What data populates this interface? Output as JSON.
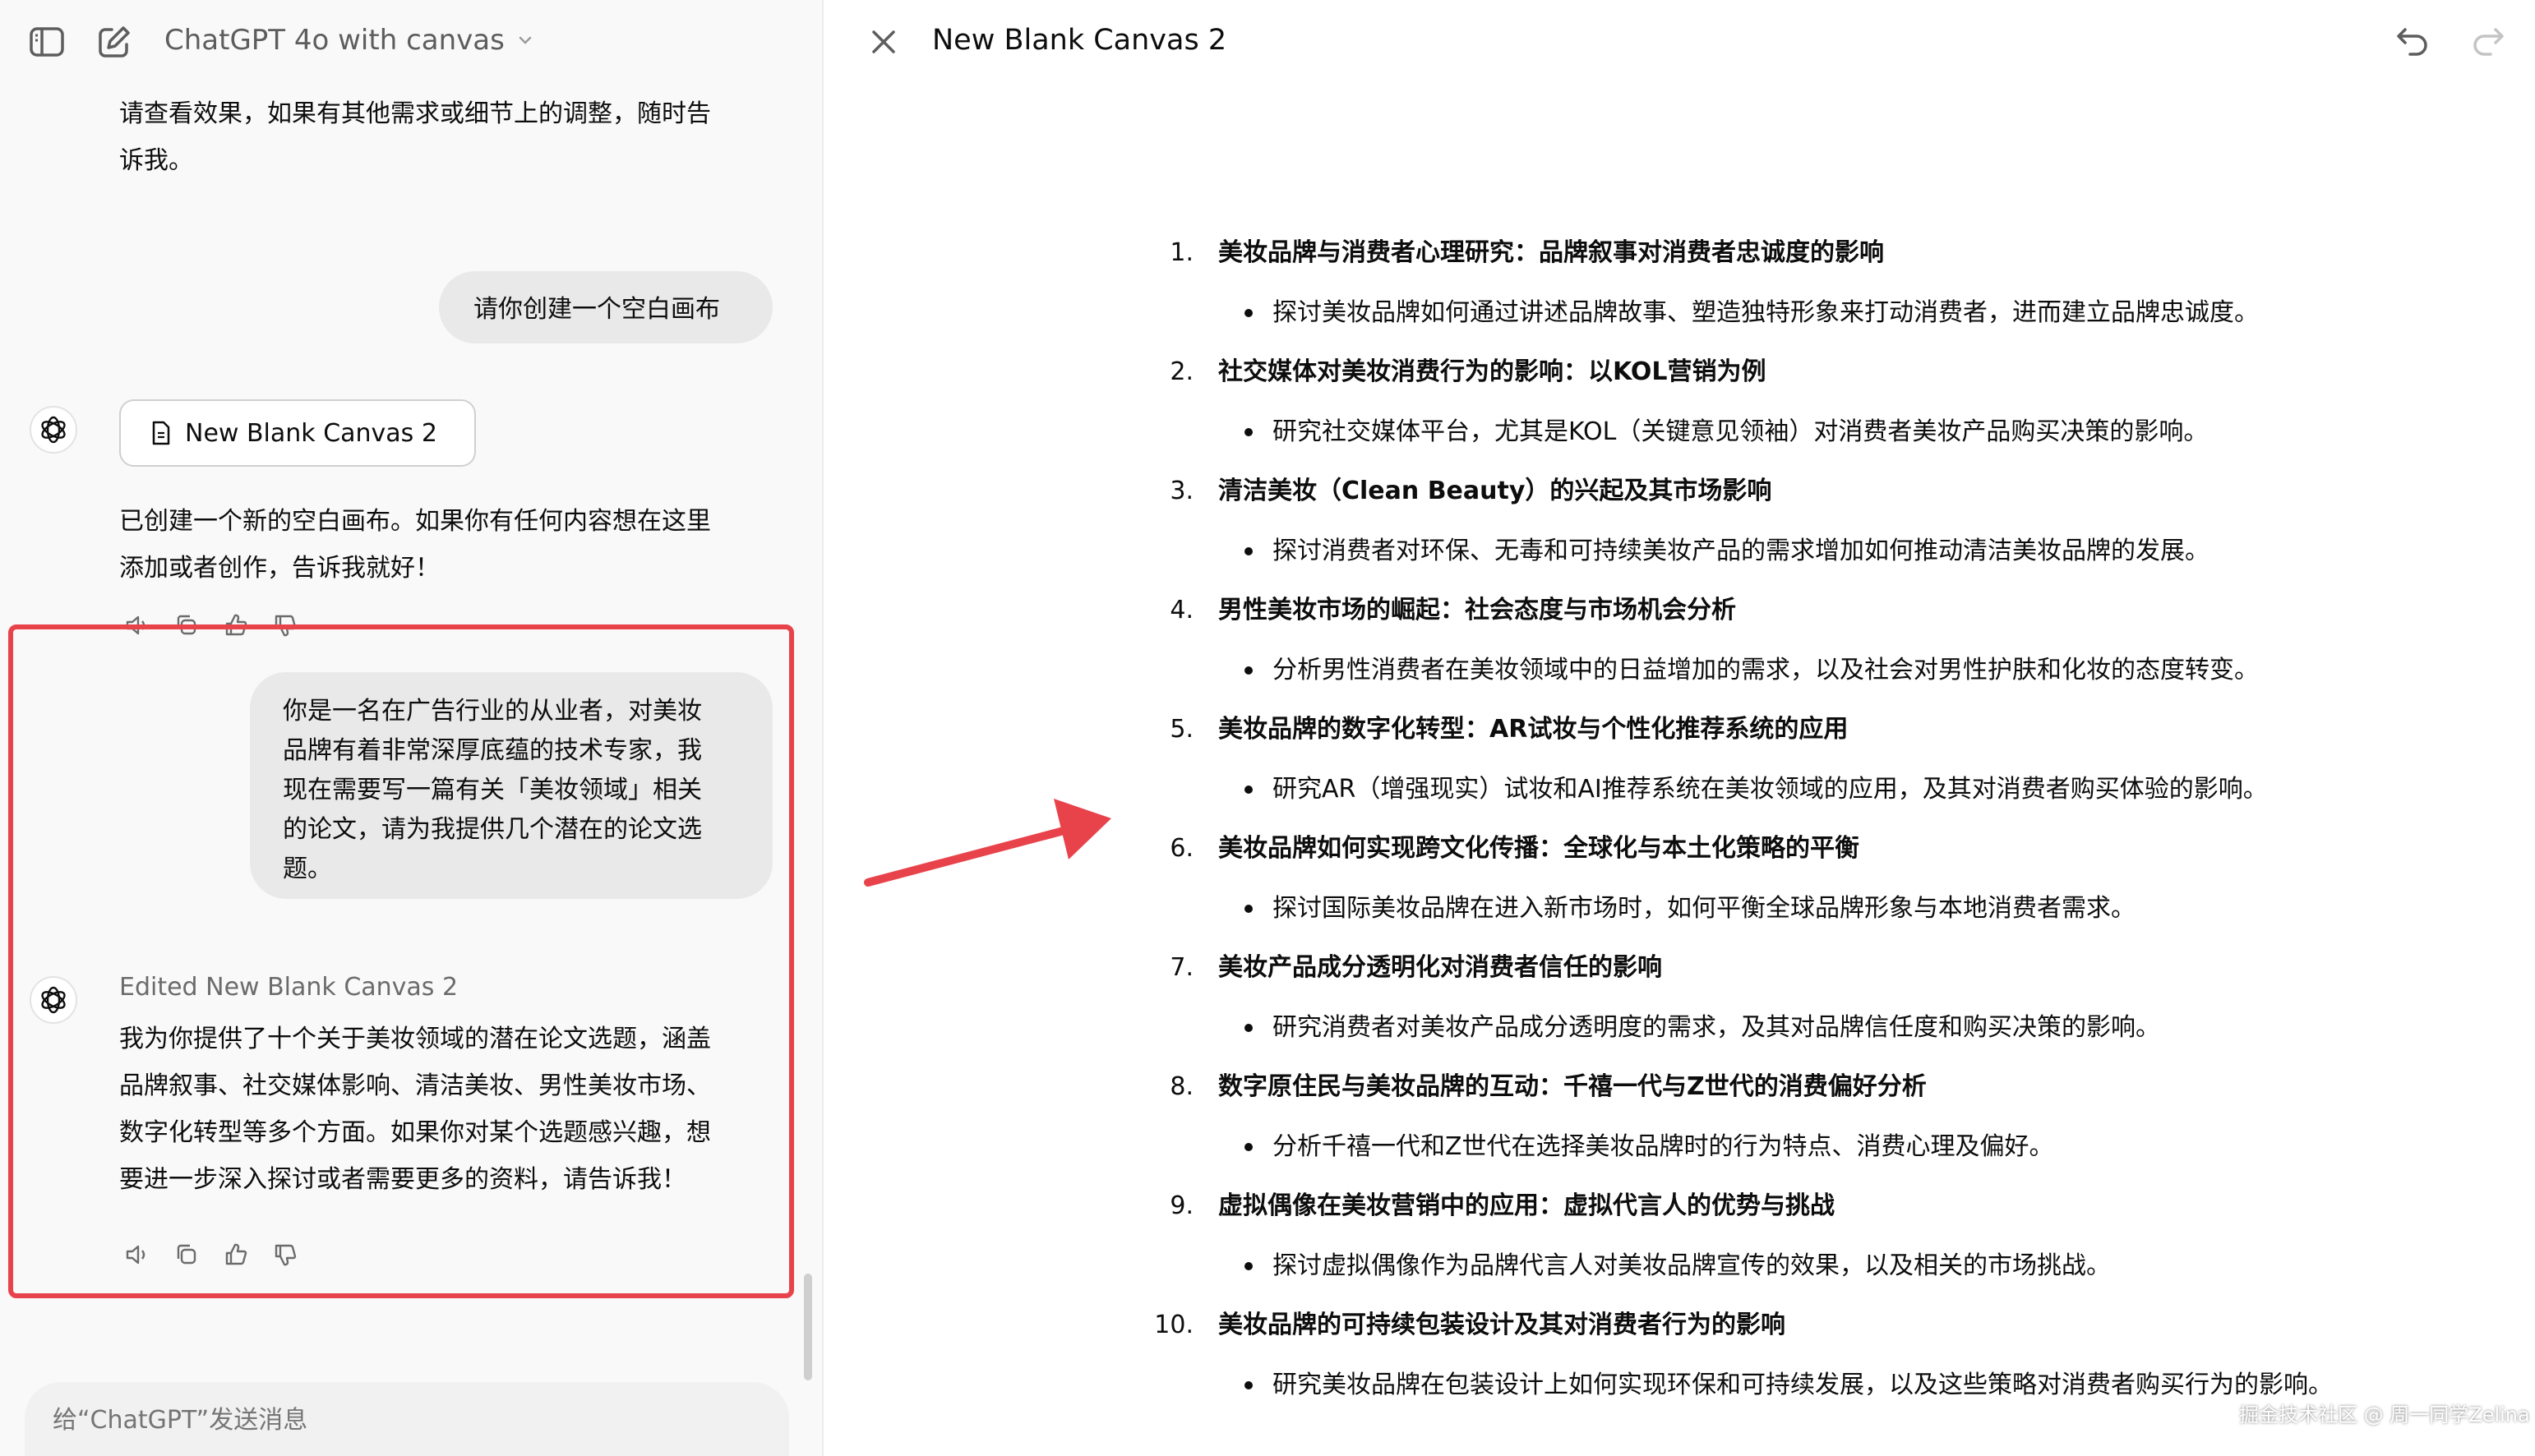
{
  "chat": {
    "model_title": "ChatGPT 4o with canvas",
    "messages": {
      "assistant_intro_line1": "请查看效果，如果有其他需求或细节上的调整，随时告",
      "assistant_intro_line2": "诉我。",
      "user_request_1": "请你创建一个空白画布",
      "canvas_chip_label": "New Blank Canvas 2",
      "assistant_created_line1": "已创建一个新的空白画布。如果你有任何内容想在这里",
      "assistant_created_line2": "添加或者创作，告诉我就好！",
      "user_request_2_lines": [
        "你是一名在广告行业的从业者，对美妆",
        "品牌有着非常深厚底蕴的技术专家，我",
        "现在需要写一篇有关「美妆领域」相关",
        "的论文，请为我提供几个潜在的论文选",
        "题。"
      ],
      "edited_label": "Edited New Blank Canvas 2",
      "assistant_reply_lines": [
        "我为你提供了十个关于美妆领域的潜在论文选题，涵盖",
        "品牌叙事、社交媒体影响、清洁美妆、男性美妆市场、",
        "数字化转型等多个方面。如果你对某个选题感兴趣，想",
        "要进一步深入探讨或者需要更多的资料，请告诉我！"
      ]
    },
    "composer_placeholder": "给“ChatGPT”发送消息",
    "highlight_color": "#e8434b"
  },
  "canvas": {
    "title": "New Blank Canvas 2",
    "topics": [
      {
        "num": "1.",
        "title": "美妆品牌与消费者心理研究：品牌叙事对消费者忠诚度的影响",
        "bullet": "探讨美妆品牌如何通过讲述品牌故事、塑造独特形象来打动消费者，进而建立品牌忠诚度。"
      },
      {
        "num": "2.",
        "title": "社交媒体对美妆消费行为的影响：以KOL营销为例",
        "bullet": "研究社交媒体平台，尤其是KOL（关键意见领袖）对消费者美妆产品购买决策的影响。"
      },
      {
        "num": "3.",
        "title": "清洁美妆（Clean Beauty）的兴起及其市场影响",
        "bullet": "探讨消费者对环保、无毒和可持续美妆产品的需求增加如何推动清洁美妆品牌的发展。"
      },
      {
        "num": "4.",
        "title": "男性美妆市场的崛起：社会态度与市场机会分析",
        "bullet": "分析男性消费者在美妆领域中的日益增加的需求，以及社会对男性护肤和化妆的态度转变。"
      },
      {
        "num": "5.",
        "title": "美妆品牌的数字化转型：AR试妆与个性化推荐系统的应用",
        "bullet": "研究AR（增强现实）试妆和AI推荐系统在美妆领域的应用，及其对消费者购买体验的影响。"
      },
      {
        "num": "6.",
        "title": "美妆品牌如何实现跨文化传播：全球化与本土化策略的平衡",
        "bullet": "探讨国际美妆品牌在进入新市场时，如何平衡全球品牌形象与本地消费者需求。"
      },
      {
        "num": "7.",
        "title": "美妆产品成分透明化对消费者信任的影响",
        "bullet": "研究消费者对美妆产品成分透明度的需求，及其对品牌信任度和购买决策的影响。"
      },
      {
        "num": "8.",
        "title": "数字原住民与美妆品牌的互动：千禧一代与Z世代的消费偏好分析",
        "bullet": "分析千禧一代和Z世代在选择美妆品牌时的行为特点、消费心理及偏好。"
      },
      {
        "num": "9.",
        "title": "虚拟偶像在美妆营销中的应用：虚拟代言人的优势与挑战",
        "bullet": "探讨虚拟偶像作为品牌代言人对美妆品牌宣传的效果，以及相关的市场挑战。"
      },
      {
        "num": "10.",
        "title": "美妆品牌的可持续包装设计及其对消费者行为的影响",
        "bullet": "研究美妆品牌在包装设计上如何实现环保和可持续发展，以及这些策略对消费者购买行为的影响。"
      }
    ]
  },
  "overlay": {
    "arrow_color": "#e8434b",
    "watermark": "掘金技术社区 @ 周一同学Zelina"
  }
}
